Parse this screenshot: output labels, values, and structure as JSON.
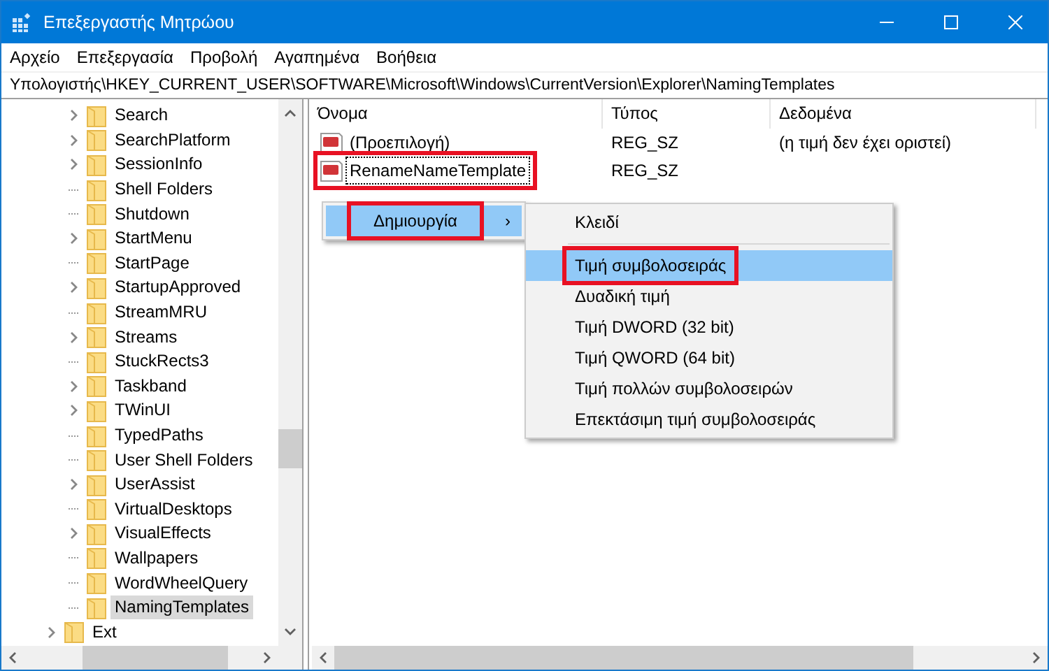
{
  "window": {
    "title": "Επεξεργαστής Μητρώου"
  },
  "menu_bar": [
    "Αρχείο",
    "Επεξεργασία",
    "Προβολή",
    "Αγαπημένα",
    "Βοήθεια"
  ],
  "address_bar": "Υπολογιστής\\HKEY_CURRENT_USER\\SOFTWARE\\Microsoft\\Windows\\CurrentVersion\\Explorer\\NamingTemplates",
  "tree": [
    {
      "children": [
        {
          "label": "Search",
          "expandable": true,
          "selected": false
        },
        {
          "label": "SearchPlatform",
          "expandable": true,
          "selected": false
        },
        {
          "label": "SessionInfo",
          "expandable": true,
          "selected": false
        },
        {
          "label": "Shell Folders",
          "expandable": false,
          "selected": false
        },
        {
          "label": "Shutdown",
          "expandable": false,
          "selected": false
        },
        {
          "label": "StartMenu",
          "expandable": true,
          "selected": false
        },
        {
          "label": "StartPage",
          "expandable": false,
          "selected": false
        },
        {
          "label": "StartupApproved",
          "expandable": true,
          "selected": false
        },
        {
          "label": "StreamMRU",
          "expandable": false,
          "selected": false
        },
        {
          "label": "Streams",
          "expandable": true,
          "selected": false
        },
        {
          "label": "StuckRects3",
          "expandable": false,
          "selected": false
        },
        {
          "label": "Taskband",
          "expandable": true,
          "selected": false
        },
        {
          "label": "TWinUI",
          "expandable": true,
          "selected": false
        },
        {
          "label": "TypedPaths",
          "expandable": false,
          "selected": false
        },
        {
          "label": "User Shell Folders",
          "expandable": false,
          "selected": false
        },
        {
          "label": "UserAssist",
          "expandable": true,
          "selected": false
        },
        {
          "label": "VirtualDesktops",
          "expandable": false,
          "selected": false
        },
        {
          "label": "VisualEffects",
          "expandable": true,
          "selected": false
        },
        {
          "label": "Wallpapers",
          "expandable": false,
          "selected": false
        },
        {
          "label": "WordWheelQuery",
          "expandable": false,
          "selected": false
        },
        {
          "label": "NamingTemplates",
          "expandable": false,
          "selected": true
        }
      ]
    },
    {
      "label": "Ext",
      "expandable": true,
      "selected": false
    }
  ],
  "values": {
    "columns": [
      "Όνομα",
      "Τύπος",
      "Δεδομένα"
    ],
    "rows": [
      {
        "name": "(Προεπιλογή)",
        "type": "REG_SZ",
        "data": "(η τιμή δεν έχει οριστεί)",
        "editing": false,
        "highlighted": false
      },
      {
        "name": "RenameNameTemplate",
        "type": "REG_SZ",
        "editing": true,
        "highlighted": true
      }
    ]
  },
  "context_menu": [
    {
      "label": "Δημιουργία",
      "arrow": "›",
      "selected": true,
      "highlighted": true
    }
  ],
  "submenu": [
    {
      "kind": "item",
      "label": "Κλειδί",
      "selected": false,
      "highlighted": false
    },
    {
      "kind": "separator"
    },
    {
      "kind": "item",
      "label": "Τιμή συμβολοσειράς",
      "selected": true,
      "highlighted": true
    },
    {
      "kind": "item",
      "label": "Δυαδική τιμή",
      "selected": false,
      "highlighted": false
    },
    {
      "kind": "item",
      "label": "Τιμή DWORD (32 bit)",
      "selected": false,
      "highlighted": false
    },
    {
      "kind": "item",
      "label": "Τιμή QWORD (64 bit)",
      "selected": false,
      "highlighted": false
    },
    {
      "kind": "item",
      "label": "Τιμή πολλών συμβολοσειρών",
      "selected": false,
      "highlighted": false
    },
    {
      "kind": "item",
      "label": "Επεκτάσιμη τιμή συμβολοσειράς",
      "selected": false,
      "highlighted": false
    }
  ]
}
